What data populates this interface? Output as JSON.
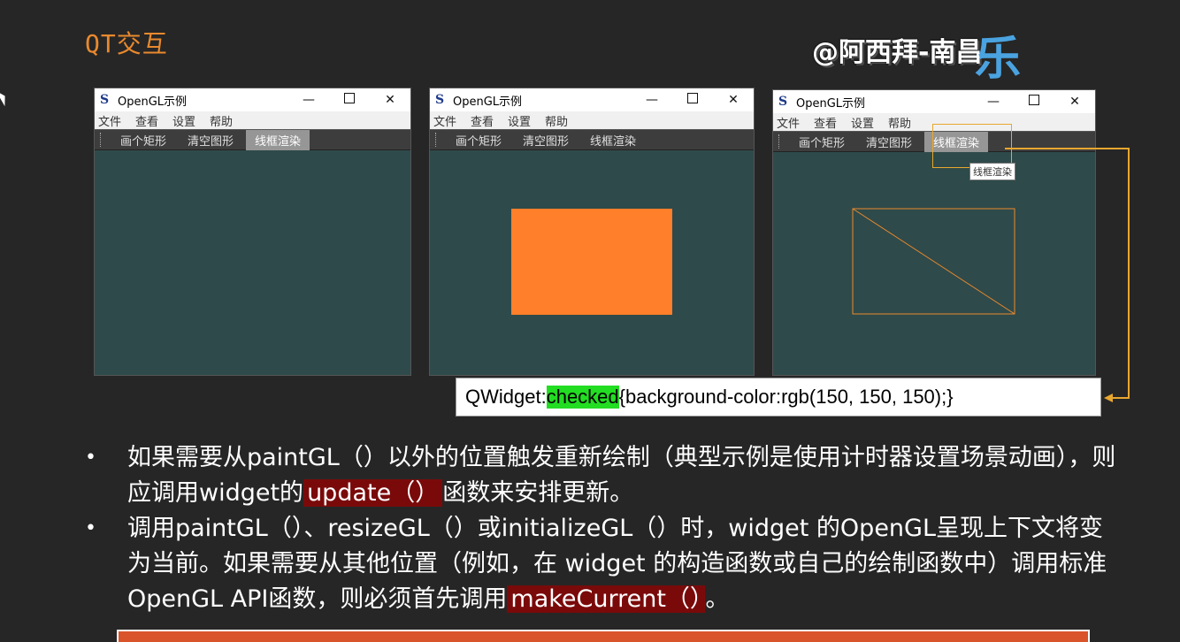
{
  "slide_title": "QT交互",
  "watermark": {
    "text": "@阿西拜-南昌",
    "logo": "乐"
  },
  "windows": [
    {
      "title": "OpenGL示例",
      "menu": [
        "文件",
        "查看",
        "设置",
        "帮助"
      ],
      "tools": [
        "画个矩形",
        "清空图形",
        "线框渲染"
      ],
      "checked_tool": "线框渲染"
    },
    {
      "title": "OpenGL示例",
      "menu": [
        "文件",
        "查看",
        "设置",
        "帮助"
      ],
      "tools": [
        "画个矩形",
        "清空图形",
        "线框渲染"
      ]
    },
    {
      "title": "OpenGL示例",
      "menu": [
        "文件",
        "查看",
        "设置",
        "帮助"
      ],
      "tools": [
        "画个矩形",
        "清空图形",
        "线框渲染"
      ],
      "checked_tool": "线框渲染",
      "tooltip": "线框渲染"
    }
  ],
  "window_buttons": {
    "minimize": "—",
    "maximize": "",
    "close": "✕"
  },
  "code": {
    "prefix": "QWidget:",
    "highlight": "checked",
    "suffix": "{background-color:rgb(150, 150, 150);}"
  },
  "bullets": {
    "b1_part1": "如果需要从paintGL（）以外的位置触发重新绘制（典型示例是使用计时器设置场景动画），则应调用widget的",
    "b1_hl": "update（）",
    "b1_part2": "函数来安排更新。",
    "b2_part1": "调用paintGL（）、resizeGL（）或initializeGL（）时，widget 的OpenGL呈现上下文将变为当前。如果需要从其他位置（例如，在 widget 的构造函数或自己的绘制函数中）调用标准OpenGL API函数，则必须首先调用",
    "b2_hl": "makeCurrent（）",
    "b2_part2": "。"
  },
  "colors": {
    "background": "#262626",
    "title": "#e8892e",
    "gl_clear": "#2f4a4a",
    "rect": "#ff7f2a",
    "checked": "#969696",
    "code_highlight": "#22dd22",
    "red_highlight": "#7a0a0a"
  }
}
